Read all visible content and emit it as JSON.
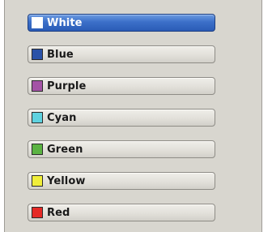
{
  "options": [
    {
      "label": "White",
      "swatch_color": "#ffffff",
      "selected": true
    },
    {
      "label": "Blue",
      "swatch_color": "#2a52a8",
      "selected": false
    },
    {
      "label": "Purple",
      "swatch_color": "#a453a6",
      "selected": false
    },
    {
      "label": "Cyan",
      "swatch_color": "#5fd2df",
      "selected": false
    },
    {
      "label": "Green",
      "swatch_color": "#5bb342",
      "selected": false
    },
    {
      "label": "Yellow",
      "swatch_color": "#f0ee3a",
      "selected": false
    },
    {
      "label": "Red",
      "swatch_color": "#e52a26",
      "selected": false
    }
  ]
}
